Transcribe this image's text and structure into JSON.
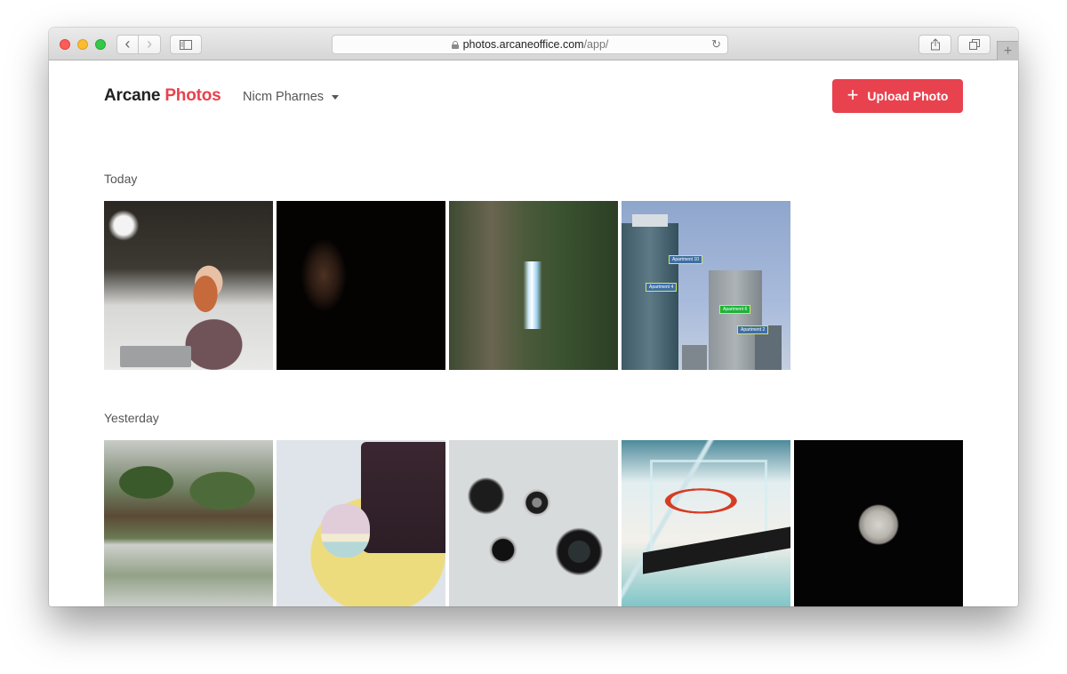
{
  "browser": {
    "url_host": "photos.arcaneoffice.com",
    "url_path": "/app/",
    "icons": {
      "back": "chevron-left-icon",
      "forward": "chevron-right-icon",
      "sidebar": "sidebar-icon",
      "lock": "lock-icon",
      "reload": "reload-icon",
      "share": "share-icon",
      "tabs": "tabs-icon",
      "new_tab": "plus-icon"
    },
    "glyphs": {
      "back": "‹",
      "forward": "›",
      "reload": "↻",
      "share": "⇪",
      "tabs": "❐",
      "new_tab": "+"
    }
  },
  "header": {
    "brand_primary": "Arcane",
    "brand_accent": "Photos",
    "user_name": "Nicm Pharnes",
    "upload_label": "Upload Photo",
    "upload_icon": "+",
    "accent_color": "#e8424f"
  },
  "sections": [
    {
      "title": "Today",
      "photos": [
        {
          "subject": "woman-with-laptop-in-cafe"
        },
        {
          "subject": "man-portrait-in-dark"
        },
        {
          "subject": "forest-waterfall"
        },
        {
          "subject": "apartment-towers-with-labels",
          "labels": [
            "Apartment 10",
            "Apartment 4",
            "Apartment 6",
            "Apartment 2"
          ],
          "highlighted_label": "Apartment 6"
        }
      ]
    },
    {
      "title": "Yesterday",
      "photos": [
        {
          "subject": "palm-huts-reflection"
        },
        {
          "subject": "chocolate-cake-and-macaron"
        },
        {
          "subject": "camera-lenses"
        },
        {
          "subject": "basketball-hoop"
        },
        {
          "subject": "moon-night-sky"
        }
      ]
    }
  ]
}
